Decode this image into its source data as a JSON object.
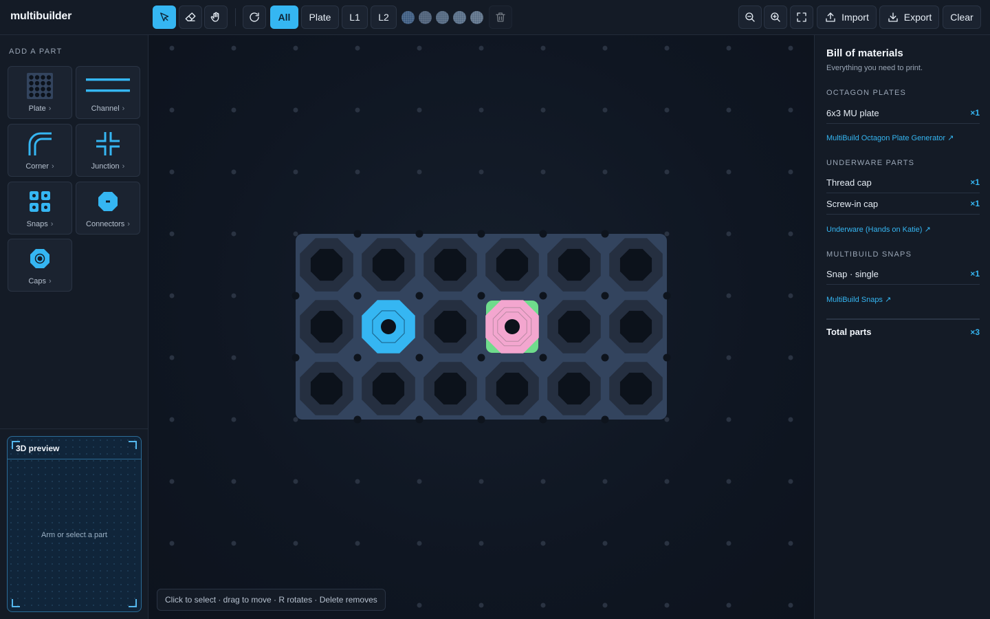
{
  "app": {
    "title": "multibuilder"
  },
  "toolbar": {
    "tools": [
      "select-tool",
      "eraser-tool",
      "pan-tool"
    ],
    "rotate_icon": "rotate-icon",
    "layer_filters": [
      {
        "label": "All",
        "active": true
      },
      {
        "label": "Plate",
        "active": false
      },
      {
        "label": "L1",
        "active": false
      },
      {
        "label": "L2",
        "active": false
      }
    ],
    "swatch_colors": [
      "#3d5b80",
      "#4b5d76",
      "#50657e",
      "#566c86",
      "#5c7088"
    ],
    "delete_icon": "trash-icon",
    "zoom_out_icon": "zoom-out-icon",
    "zoom_in_icon": "zoom-in-icon",
    "fullscreen_icon": "fullscreen-icon",
    "import_label": "Import",
    "export_label": "Export",
    "clear_label": "Clear"
  },
  "sidebar": {
    "section_label": "ADD A PART",
    "parts": [
      {
        "label": "Plate",
        "icon": "plate-icon"
      },
      {
        "label": "Channel",
        "icon": "channel-icon"
      },
      {
        "label": "Corner",
        "icon": "corner-icon"
      },
      {
        "label": "Junction",
        "icon": "junction-icon"
      },
      {
        "label": "Snaps",
        "icon": "snaps-icon"
      },
      {
        "label": "Connectors",
        "icon": "connector-icon"
      },
      {
        "label": "Caps",
        "icon": "cap-icon"
      }
    ],
    "chevron": "›"
  },
  "preview": {
    "title": "3D preview",
    "message": "Arm or select a part"
  },
  "canvas": {
    "plate_grid": {
      "cols": 6,
      "rows": 3
    },
    "placed_parts": [
      {
        "type": "thread-cap",
        "col": 2,
        "row": 2,
        "color": "#35b6f2"
      },
      {
        "type": "screw-in-cap",
        "col": 4,
        "row": 2,
        "color": "#f3a6cf",
        "accent": "#6fdc8c"
      }
    ],
    "colors": {
      "plate": "#33445e",
      "cell": "#252f40",
      "hole": "#0c121b",
      "dot": "#2a3342",
      "node": "#0e141d"
    },
    "hint": "Click to select · drag to move · R rotates · Delete removes"
  },
  "bom": {
    "title": "Bill of materials",
    "subtitle": "Everything you need to print.",
    "sections": [
      {
        "heading": "OCTAGON PLATES",
        "items": [
          {
            "name": "6x3 MU plate",
            "qty": "×1"
          }
        ],
        "link": "MultiBuild Octagon Plate Generator ↗"
      },
      {
        "heading": "UNDERWARE PARTS",
        "items": [
          {
            "name": "Thread cap",
            "qty": "×1"
          },
          {
            "name": "Screw-in cap",
            "qty": "×1"
          }
        ],
        "link": "Underware (Hands on Katie) ↗"
      },
      {
        "heading": "MULTIBUILD SNAPS",
        "items": [
          {
            "name": "Snap · single",
            "qty": "×1"
          }
        ],
        "link": "MultiBuild Snaps ↗"
      }
    ],
    "total_label": "Total parts",
    "total_qty": "×3"
  }
}
